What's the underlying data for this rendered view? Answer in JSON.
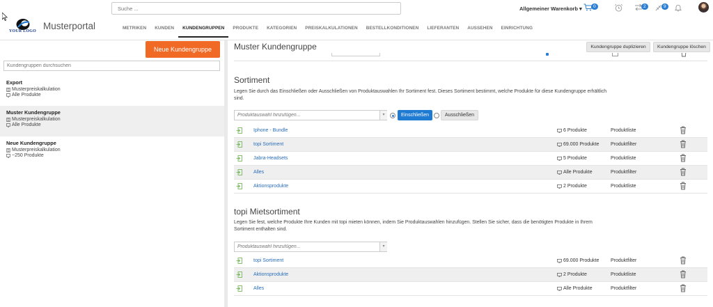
{
  "header": {
    "search_placeholder": "Suche ...",
    "cart_label": "Allgemeiner Warenkorb ▾",
    "cart_badge": "0",
    "badge_two": "2",
    "badge_nine": "9",
    "logo_text": "YOUR LOGO",
    "portal_title": "Musterportal",
    "nav": [
      "METRIKEN",
      "KUNDEN",
      "KUNDENGRUPPEN",
      "PRODUKTE",
      "KATEGORIEN",
      "PREISKALKULATIONEN",
      "BESTELLKONDITIONEN",
      "LIEFERANTEN",
      "AUSSEHEN",
      "EINRICHTUNG"
    ],
    "nav_active": "KUNDENGRUPPEN",
    "accent": "#2a7fd4"
  },
  "left": {
    "new_button": "Neue Kundengruppe",
    "new_button_color": "#f06a25",
    "search_placeholder": "Kundengruppen durchsuchen",
    "groups": [
      {
        "name": "Export",
        "calc": "Musterpreiskalkulation",
        "products": "Alle Produkte",
        "selected": false
      },
      {
        "name": "Muster Kundengruppe",
        "calc": "Musterpreiskalkulation",
        "products": "Alle Produkte",
        "selected": true
      },
      {
        "name": "Neue Kundengruppe",
        "calc": "Musterpreiskalkulation",
        "products": "~250 Produkte",
        "selected": false
      }
    ]
  },
  "main": {
    "title": "Muster Kundengruppe",
    "duplicate_button": "Kundengruppe duplizieren",
    "delete_button": "Kundengruppe löschen",
    "sortiment": {
      "title": "Sortiment",
      "description": "Legen Sie durch das Einschließen oder Ausschließen von Produktauswahlen Ihr Sortiment fest. Dieses Sortiment bestimmt, welche Produkte für diese Kundengruppe erhältlich sind.",
      "picker_placeholder": "Produktauswahl hinzufügen...",
      "include_label": "Einschließen",
      "exclude_label": "Ausschließen",
      "rows": [
        {
          "name": "Iphone - Bundle",
          "count": "6 Produkte",
          "kind": "Produktliste"
        },
        {
          "name": "topi Sortiment",
          "count": "69.000 Produkte",
          "kind": "Produktfilter"
        },
        {
          "name": "Jabra-Headsets",
          "count": "5 Produkte",
          "kind": "Produktliste"
        },
        {
          "name": "Alles",
          "count": "Alle Produkte",
          "kind": "Produktfilter"
        },
        {
          "name": "Aktionsprodukte",
          "count": "2 Produkte",
          "kind": "Produktliste"
        }
      ]
    },
    "miet": {
      "title": "topi Mietsortiment",
      "description": "Legen Sie fest, welche Produkte Ihre Kunden mit topi mieten können, indem Sie Produktauswahlen hinzufügen. Stellen Sie sicher, dass die benötigten Produkte in Ihrem Sortiment enthalten sind.",
      "picker_placeholder": "Produktauswahl hinzufügen...",
      "rows": [
        {
          "name": "topi Sortiment",
          "count": "69.000 Produkte",
          "kind": "Produktfilter"
        },
        {
          "name": "Aktionsprodukte",
          "count": "2 Produkte",
          "kind": "Produktliste"
        },
        {
          "name": "Alles",
          "count": "Alle Produkte",
          "kind": "Produktfilter"
        }
      ]
    }
  }
}
